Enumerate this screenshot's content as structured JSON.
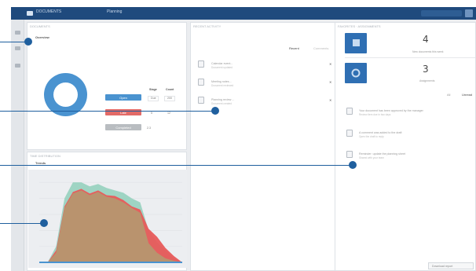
{
  "topbar": {
    "brand": "DOCUMENTS",
    "nav": "Planning"
  },
  "panels": {
    "summary": {
      "header": "DOCUMENTS",
      "title": "Overview"
    },
    "history": {
      "header": "TIME DISTRIBUTION",
      "title": "Trends"
    },
    "list": {
      "header": "RECENT ACTIVITY",
      "tab_active": "Recent",
      "tab_other": "Comments"
    },
    "right": {
      "header": "FAVORITES · ASSIGNMENTS",
      "tab_a": "All",
      "tab_b": "Unread"
    }
  },
  "legend": [
    {
      "label": "Open",
      "color": "#4a93d0"
    },
    {
      "label": "Late",
      "color": "#e26a67"
    },
    {
      "label": "Completed",
      "color": "#b9bdc1"
    }
  ],
  "summary_table": {
    "headers": [
      "Stage",
      "Count"
    ],
    "rows": [
      [
        "Due",
        "200"
      ],
      [
        "5",
        "12"
      ],
      [
        "2.3",
        ""
      ]
    ]
  },
  "list_items": [
    {
      "title": "Calendar event...",
      "subtitle": "Document updated"
    },
    {
      "title": "Meeting notes...",
      "subtitle": "Document reviewed"
    },
    {
      "title": "Planning review ...",
      "subtitle": "Document created"
    }
  ],
  "tiles": [
    {
      "value": "4",
      "caption": "New documents this week",
      "icon": "folder-icon"
    },
    {
      "value": "3",
      "caption": "Assignments",
      "icon": "circle-icon"
    }
  ],
  "notifications": [
    {
      "title": "Your document has been approved by the manager",
      "subtitle": "Review item due in two days"
    },
    {
      "title": "A comment was added to the draft",
      "subtitle": "Open the draft to reply"
    },
    {
      "title": "Reminder: update the planning sheet",
      "subtitle": "Shared with your team"
    }
  ],
  "chart_data": {
    "type": "area",
    "x": [
      0,
      1,
      2,
      3,
      4,
      5,
      6,
      7,
      8,
      9,
      10,
      11,
      12,
      13,
      14,
      15,
      16,
      17
    ],
    "series": [
      {
        "color": "#9ad2c0",
        "values": [
          0,
          0,
          2,
          8,
          10,
          10,
          9.5,
          9.8,
          9.3,
          9,
          8.7,
          8,
          7.5,
          4,
          2.5,
          1.5,
          0.5,
          0
        ]
      },
      {
        "color": "#e85a5a",
        "values": [
          0,
          0,
          1.5,
          7,
          8.8,
          9.2,
          8.6,
          9,
          8.4,
          8.3,
          7.8,
          7,
          6.6,
          4.2,
          3.2,
          1.8,
          0.8,
          0
        ]
      },
      {
        "color": "#b9936e",
        "values": [
          0,
          0,
          1.2,
          6.8,
          8.6,
          9,
          8.4,
          8.8,
          8.2,
          8,
          7.5,
          6.8,
          6.2,
          2.4,
          1.2,
          0.5,
          0.2,
          0
        ]
      }
    ],
    "ylim": [
      0,
      11
    ],
    "grid": true
  },
  "footer": {
    "button": "Download report"
  }
}
